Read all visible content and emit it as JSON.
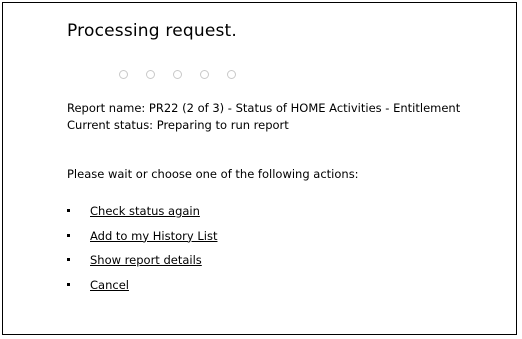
{
  "title": "Processing request.",
  "progress": {
    "dot_count": 5,
    "dot_color": "#c9c9c9"
  },
  "report": {
    "name_line": "Report name: PR22 (2 of 3) - Status of HOME Activities - Entitlement",
    "status_line": "Current status: Preparing to run report"
  },
  "prompt": "Please wait or choose one of the following actions:",
  "actions": [
    {
      "label": "Check status again"
    },
    {
      "label": "Add to my History List"
    },
    {
      "label": "Show report details"
    },
    {
      "label": "Cancel"
    }
  ]
}
